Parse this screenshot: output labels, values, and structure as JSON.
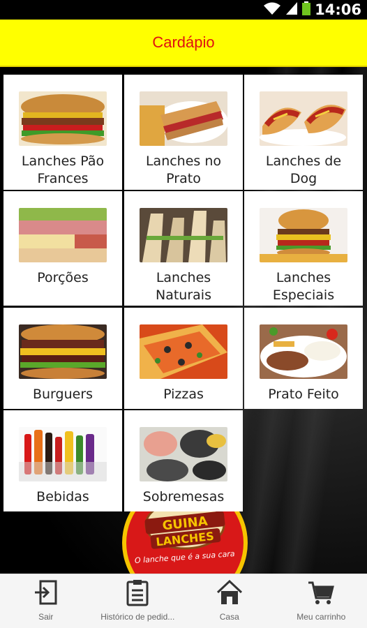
{
  "status_bar": {
    "time": "14:06"
  },
  "header": {
    "title": "Cardápio"
  },
  "menu": {
    "items": [
      {
        "label": "Lanches Pão Frances",
        "image": "sandwich-french-bread"
      },
      {
        "label": "Lanches no Prato",
        "image": "sandwich-plate"
      },
      {
        "label": "Lanches de Dog",
        "image": "hot-dog"
      },
      {
        "label": "Porções",
        "image": "cold-cuts-platter"
      },
      {
        "label": "Lanches Naturais",
        "image": "natural-sandwiches"
      },
      {
        "label": "Lanches Especiais",
        "image": "special-burger"
      },
      {
        "label": "Burguers",
        "image": "burger"
      },
      {
        "label": "Pizzas",
        "image": "pizza"
      },
      {
        "label": "Prato Feito",
        "image": "meal-plate"
      },
      {
        "label": "Bebidas",
        "image": "drinks"
      },
      {
        "label": "Sobremesas",
        "image": "desserts"
      }
    ]
  },
  "logo": {
    "name_line1": "GUINA",
    "name_line2": "LANCHES",
    "slogan": "O lanche que é a sua cara"
  },
  "bottom_nav": {
    "items": [
      {
        "label": "Sair",
        "icon": "exit-icon"
      },
      {
        "label": "Histórico de pedid...",
        "icon": "clipboard-icon"
      },
      {
        "label": "Casa",
        "icon": "home-icon"
      },
      {
        "label": "Meu carrinho",
        "icon": "cart-icon"
      }
    ]
  },
  "colors": {
    "header_bg": "#ffff00",
    "header_text": "#e01010",
    "tile_bg": "#ffffff",
    "background": "#000000",
    "logo_red": "#d81818"
  }
}
